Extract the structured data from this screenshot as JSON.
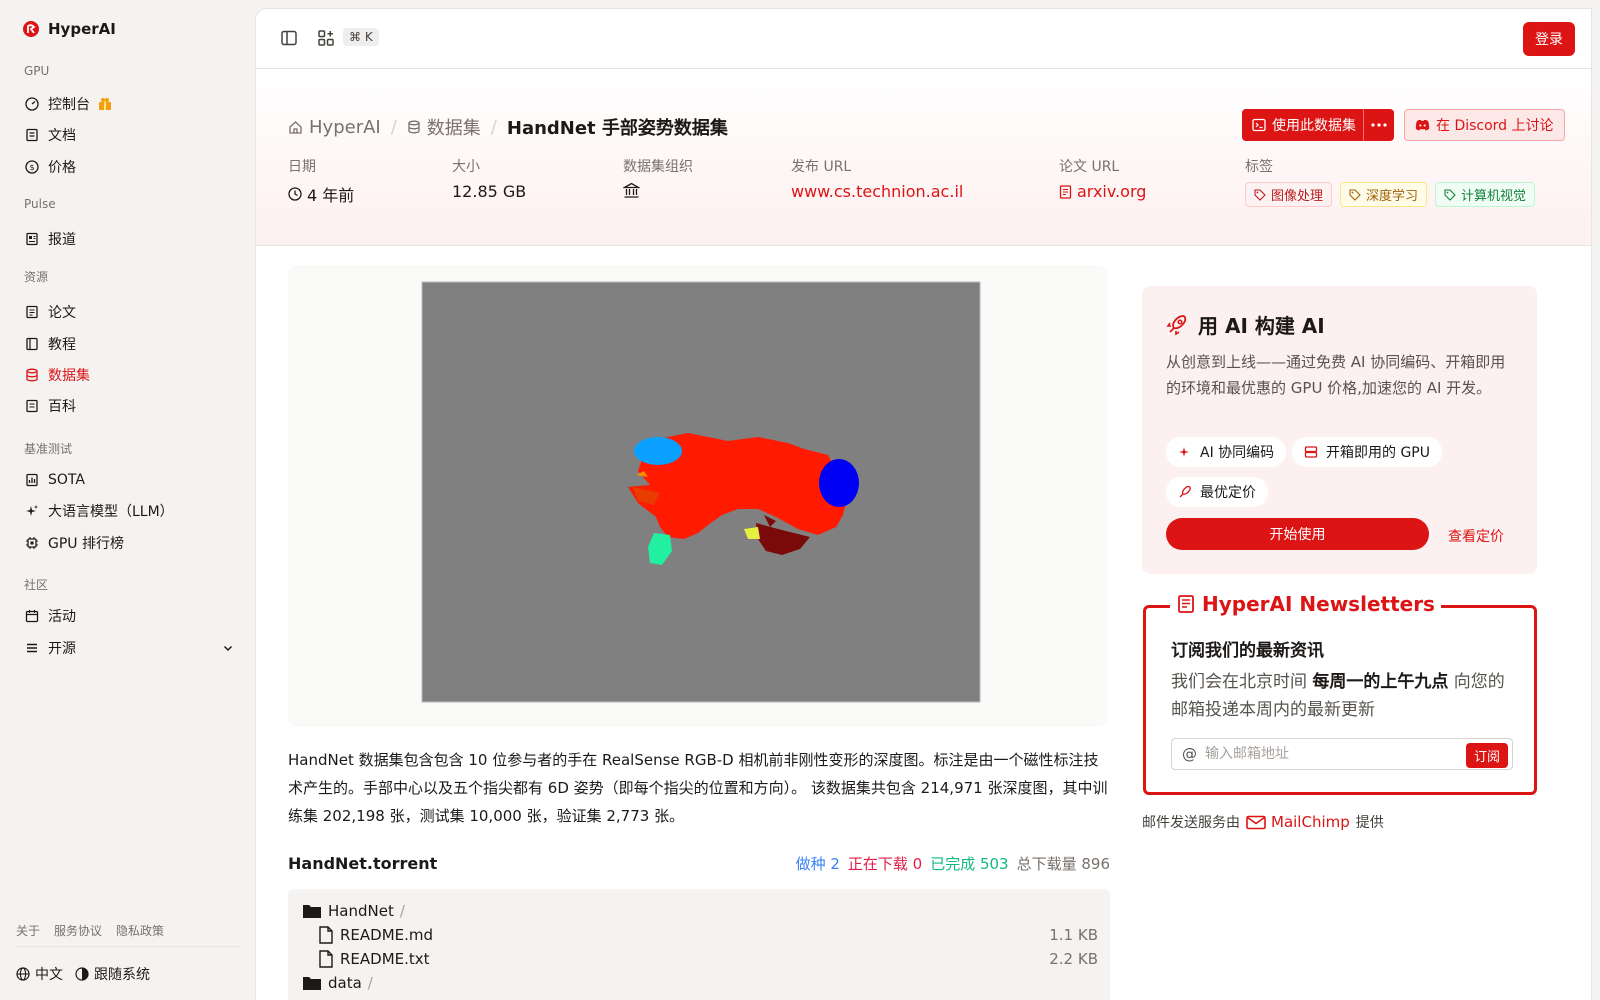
{
  "app": {
    "name": "HyperAI"
  },
  "sidebar": {
    "sections": [
      {
        "label": "GPU",
        "items": [
          {
            "label": "控制台",
            "icon": "gauge-icon"
          },
          {
            "label": "文档",
            "icon": "book-icon"
          },
          {
            "label": "价格",
            "icon": "dollar-icon"
          }
        ]
      },
      {
        "label": "Pulse",
        "items": [
          {
            "label": "报道",
            "icon": "newspaper-icon"
          }
        ]
      },
      {
        "label": "资源",
        "items": [
          {
            "label": "论文",
            "icon": "paper-icon"
          },
          {
            "label": "教程",
            "icon": "book-open-icon"
          },
          {
            "label": "数据集",
            "icon": "database-icon"
          },
          {
            "label": "百科",
            "icon": "notebook-icon"
          }
        ]
      },
      {
        "label": "基准测试",
        "items": [
          {
            "label": "SOTA",
            "icon": "trophy-icon"
          },
          {
            "label": "大语言模型（LLM）",
            "icon": "sparkles-icon"
          },
          {
            "label": "GPU 排行榜",
            "icon": "cpu-icon"
          }
        ]
      },
      {
        "label": "社区",
        "items": [
          {
            "label": "活动",
            "icon": "calendar-icon"
          },
          {
            "label": "开源",
            "icon": "list-icon"
          }
        ]
      }
    ],
    "footer_links": [
      "关于",
      "服务协议",
      "隐私政策"
    ],
    "language": "中文",
    "theme": "跟随系统"
  },
  "topbar": {
    "shortcut": "⌘ K",
    "login": "登录"
  },
  "breadcrumb": {
    "home": "HyperAI",
    "section": "数据集",
    "current": "HandNet 手部姿势数据集"
  },
  "actions": {
    "use_dataset": "使用此数据集",
    "discord": "在 Discord 上讨论"
  },
  "meta": {
    "date_label": "日期",
    "date_value": "4 年前",
    "size_label": "大小",
    "size_value": "12.85 GB",
    "org_label": "数据集组织",
    "publish_label": "发布 URL",
    "publish_value": "www.cs.technion.ac.il",
    "paper_label": "论文 URL",
    "paper_value": "arxiv.org",
    "tags_label": "标签",
    "tags": [
      {
        "label": "图像处理",
        "color": "#b91c1c",
        "bg": "#fdf2f2",
        "border": "#fecaca"
      },
      {
        "label": "深度学习",
        "color": "#a16207",
        "bg": "#fefce8",
        "border": "#fde68a"
      },
      {
        "label": "计算机视觉",
        "color": "#15803d",
        "bg": "#f0fdf4",
        "border": "#bbf7d0"
      }
    ]
  },
  "description": "HandNet 数据集包含包含 10 位参与者的手在 RealSense RGB-D 相机前非刚性变形的深度图。标注是由一个磁性标注技术产生的。手部中心以及五个指尖都有 6D 姿势（即每个指尖的位置和方向）。 该数据集共包含 214,971 张深度图，其中训练集 202,198 张，测试集 10,000 张，验证集 2,773 张。",
  "torrent": {
    "name": "HandNet.torrent",
    "seeding": "做种 2",
    "downloading": "正在下载 0",
    "completed": "已完成 503",
    "total": "总下载量 896",
    "files": [
      {
        "name": "HandNet",
        "type": "folder",
        "size": ""
      },
      {
        "name": "README.md",
        "type": "file",
        "size": "1.1 KB"
      },
      {
        "name": "README.txt",
        "type": "file",
        "size": "2.2 KB"
      },
      {
        "name": "data",
        "type": "folder",
        "size": ""
      }
    ]
  },
  "promo": {
    "title": "用 AI 构建 AI",
    "desc": "从创意到上线——通过免费 AI 协同编码、开箱即用的环境和最优惠的 GPU 价格,加速您的 AI 开发。",
    "chips": [
      "AI 协同编码",
      "开箱即用的 GPU",
      "最优定价"
    ],
    "start": "开始使用",
    "pricing": "查看定价"
  },
  "newsletter": {
    "legend": "HyperAI Newsletters",
    "title": "订阅我们的最新资讯",
    "desc_pre": "我们会在北京时间 ",
    "desc_bold": "每周一的上午九点",
    "desc_post": " 向您的邮箱投递本周内的最新更新",
    "placeholder": "输入邮箱地址",
    "subscribe": "订阅",
    "mail_by": "邮件发送服务由",
    "provider": "MailChimp",
    "provided": "提供"
  },
  "colors": {
    "accent": "#dc1414",
    "seeding": "#3b82f6",
    "downloading": "#e11d48",
    "completed": "#10b981"
  }
}
